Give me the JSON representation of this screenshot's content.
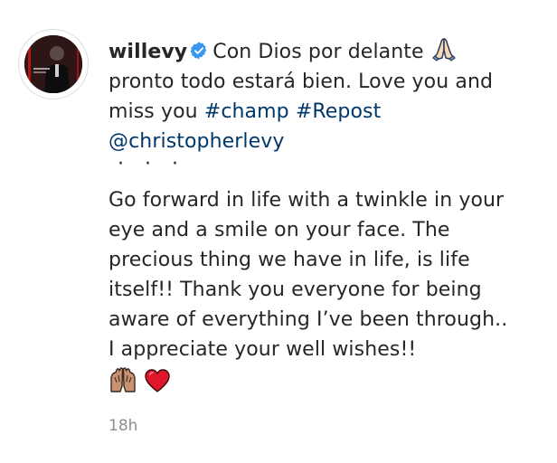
{
  "post": {
    "username": "willevy",
    "caption_intro": "Con Dios por delante",
    "caption_line2": "pronto todo estará bien. Love you and miss you",
    "hashtags": [
      "#champ",
      "#Repost"
    ],
    "mention": "@christopherlevy",
    "separator_dots": [
      "·",
      "·",
      "·"
    ],
    "body_lines": [
      "Go forward in life with a twinkle in your",
      "eye and a smile on your face. The",
      "precious thing we have in life, is life",
      "itself!! Thank you everyone for being",
      "aware of everything I’ve been through..",
      "I appreciate your well wishes!!"
    ],
    "timestamp": "18h"
  },
  "colors": {
    "link": "#00376b",
    "verified": "#3897f0",
    "heart": "#e0162b",
    "muted": "#8e8e8e"
  },
  "icons": {
    "verified": "verified-badge-icon",
    "pray": "folded-hands-icon",
    "raised_hands": "raised-hands-icon",
    "heart": "red-heart-icon"
  }
}
